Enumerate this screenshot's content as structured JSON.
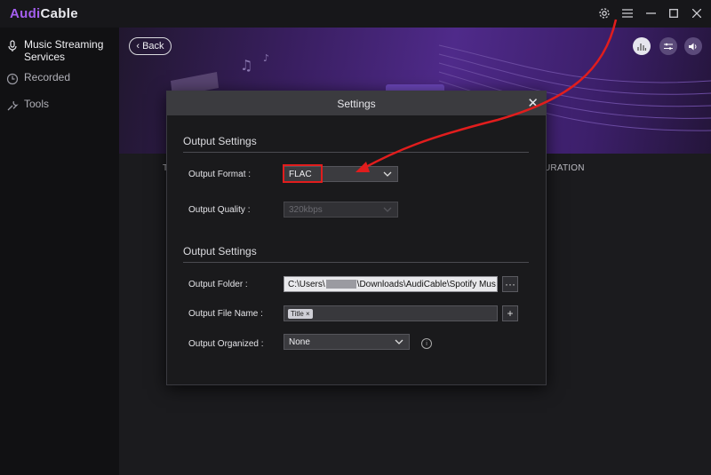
{
  "app": {
    "brand_part1": "Audi",
    "brand_part2": "Cable"
  },
  "sidebar": {
    "items": [
      {
        "label": "Music Streaming Services",
        "icon": "microphone-icon"
      },
      {
        "label": "Recorded",
        "icon": "clock-icon"
      },
      {
        "label": "Tools",
        "icon": "wrench-icon"
      }
    ]
  },
  "content": {
    "back_label": "Back",
    "columns": {
      "title_partial": "T",
      "duration_partial": "URATION"
    }
  },
  "dialog": {
    "title": "Settings",
    "section1_title": "Output Settings",
    "output_format_label": "Output Format :",
    "output_format_value": "FLAC",
    "output_quality_label": "Output Quality :",
    "output_quality_value": "320kbps",
    "section2_title": "Output Settings",
    "output_folder_label": "Output Folder :",
    "output_folder_prefix": "C:\\Users\\",
    "output_folder_suffix": "\\Downloads\\AudiCable\\Spotify Mus",
    "folder_browse_label": "···",
    "output_file_name_label": "Output File Name :",
    "file_name_tag": "Title ×",
    "add_label": "+",
    "output_organized_label": "Output Organized :",
    "output_organized_value": "None"
  },
  "colors": {
    "brand": "#a55ff0",
    "highlight": "#e11d1d"
  }
}
